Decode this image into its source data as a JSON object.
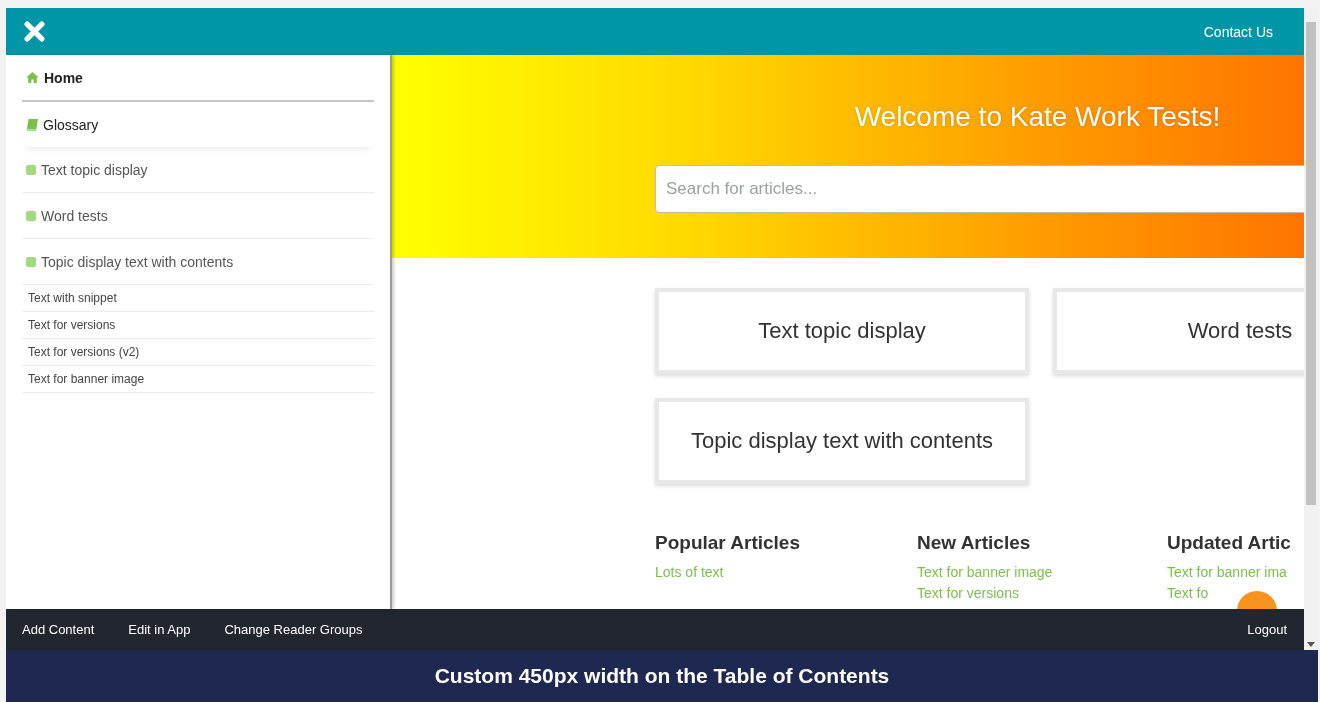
{
  "header": {
    "contact_link": "Contact Us"
  },
  "sidebar": {
    "items": [
      {
        "label": "Home",
        "kind": "home"
      },
      {
        "label": "Glossary",
        "kind": "glossary"
      },
      {
        "label": "Text topic display",
        "kind": "topic"
      },
      {
        "label": "Word tests",
        "kind": "topic"
      },
      {
        "label": "Topic display text with contents",
        "kind": "topic",
        "children": [
          {
            "label": "Text with snippet"
          },
          {
            "label": "Text for versions"
          },
          {
            "label": "Text for versions (v2)"
          },
          {
            "label": "Text for banner image"
          }
        ]
      }
    ]
  },
  "hero": {
    "title": "Welcome to Kate Work Tests!",
    "search": {
      "placeholder": "Search for articles..."
    }
  },
  "topic_cards": [
    "Text topic display",
    "Word tests",
    "Topic display text with contents"
  ],
  "article_lists": [
    {
      "heading": "Popular Articles",
      "links": [
        "Lots of text"
      ]
    },
    {
      "heading": "New Articles",
      "links": [
        "Text for banner image",
        "Text for versions"
      ]
    },
    {
      "heading": "Updated Artic",
      "links": [
        "Text for banner ima",
        "Text fo"
      ]
    }
  ],
  "footer": {
    "left_links": [
      "Add Content",
      "Edit in App",
      "Change Reader Groups"
    ],
    "right_link": "Logout"
  },
  "banner": {
    "text": "Custom 450px width on the Table of Contents"
  }
}
